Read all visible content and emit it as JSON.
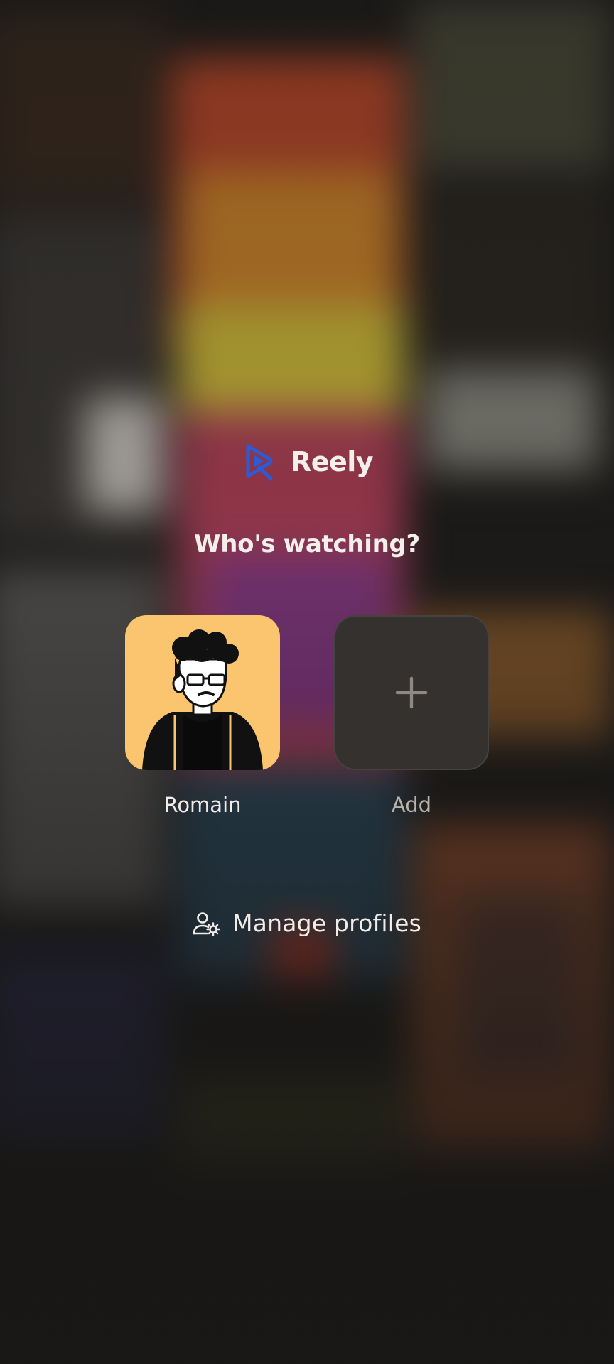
{
  "app": {
    "brand_name": "Reely",
    "brand_color": "#2b5bd7"
  },
  "profiles_screen": {
    "title": "Who's watching?",
    "profiles": [
      {
        "label": "Romain",
        "tile_color": "#fbc46e",
        "icon": "cartoon-avatar"
      },
      {
        "label": "Add",
        "tile_color": "#34312f",
        "icon": "plus-icon"
      }
    ],
    "manage": {
      "label": "Manage profiles",
      "icon": "user-settings-icon"
    }
  }
}
